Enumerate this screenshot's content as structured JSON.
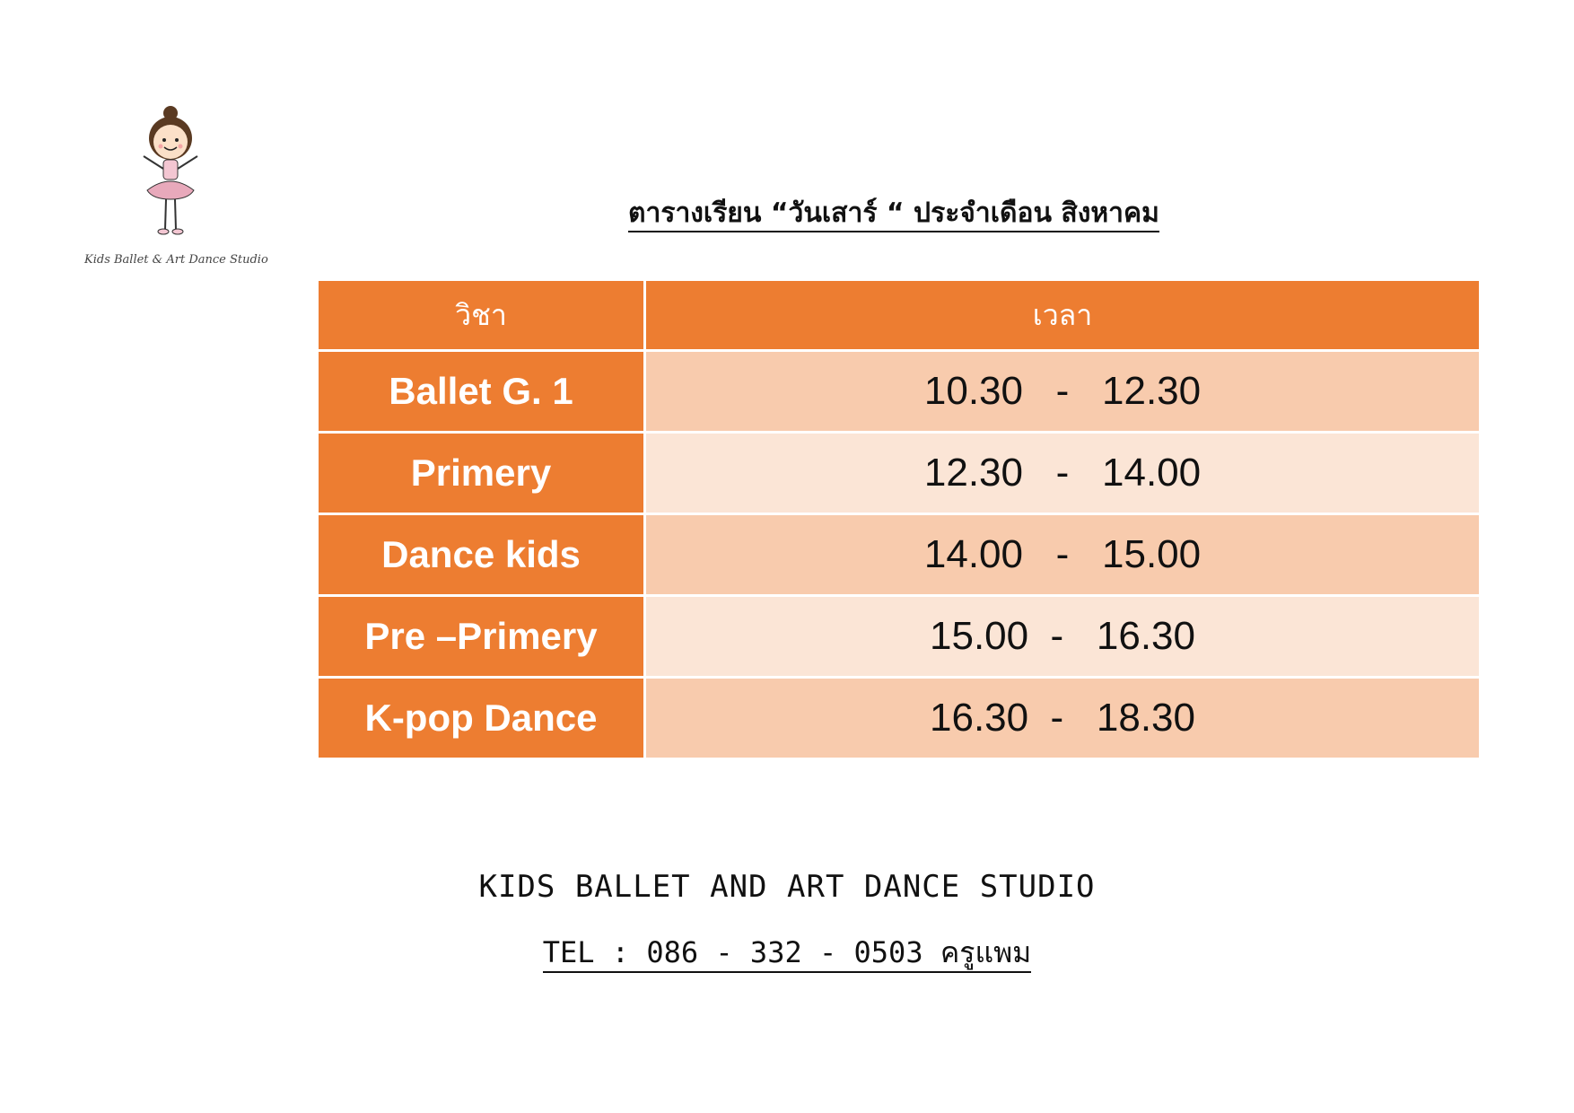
{
  "logo": {
    "caption": "Kids Ballet & Art Dance Studio"
  },
  "title": "ตารางเรียน “วันเสาร์ “ ประจำเดือน สิงหาคม",
  "table": {
    "headers": [
      "วิชา",
      "เวลา"
    ],
    "rows": [
      {
        "subject": "Ballet G. 1",
        "time": "10.30   -   12.30"
      },
      {
        "subject": "Primery",
        "time": "12.30   -   14.00"
      },
      {
        "subject": "Dance kids",
        "time": "14.00   -   15.00"
      },
      {
        "subject": "Pre –Primery",
        "time": "15.00  -   16.30"
      },
      {
        "subject": "K-pop Dance",
        "time": "16.30  -   18.30"
      }
    ]
  },
  "footer": {
    "studio": "KIDS BALLET AND ART DANCE STUDIO",
    "tel": "TEL : 086 - 332 - 0503 ครูแพม"
  },
  "colors": {
    "header_bg": "#ed7d31",
    "row_dark": "#f8cbad",
    "row_light": "#fbe5d6"
  }
}
